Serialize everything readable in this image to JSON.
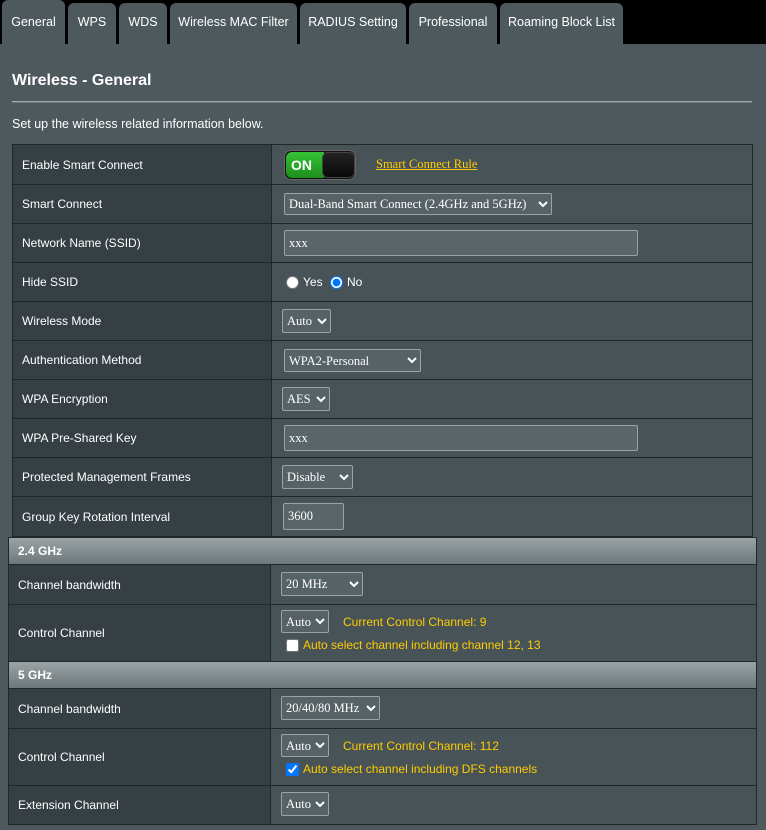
{
  "tabs": [
    {
      "label": "General",
      "active": true
    },
    {
      "label": "WPS"
    },
    {
      "label": "WDS"
    },
    {
      "label": "Wireless MAC Filter"
    },
    {
      "label": "RADIUS Setting"
    },
    {
      "label": "Professional"
    },
    {
      "label": "Roaming Block List"
    }
  ],
  "page": {
    "title": "Wireless - General",
    "description": "Set up the wireless related information below."
  },
  "general": {
    "smart_connect_enable": {
      "label": "Enable Smart Connect",
      "toggle": "ON",
      "rule_link": "Smart Connect Rule"
    },
    "smart_connect": {
      "label": "Smart Connect",
      "value": "Dual-Band Smart Connect (2.4GHz and 5GHz)"
    },
    "ssid": {
      "label": "Network Name (SSID)",
      "value": "xxx"
    },
    "hide_ssid": {
      "label": "Hide SSID",
      "yes": "Yes",
      "no": "No",
      "selected": "No"
    },
    "wireless_mode": {
      "label": "Wireless Mode",
      "value": "Auto"
    },
    "auth_method": {
      "label": "Authentication Method",
      "value": "WPA2-Personal"
    },
    "wpa_encryption": {
      "label": "WPA Encryption",
      "value": "AES"
    },
    "wpa_psk": {
      "label": "WPA Pre-Shared Key",
      "value": "xxx"
    },
    "pmf": {
      "label": "Protected Management Frames",
      "value": "Disable"
    },
    "group_key": {
      "label": "Group Key Rotation Interval",
      "value": "3600"
    }
  },
  "band_24": {
    "header": "2.4 GHz",
    "bandwidth": {
      "label": "Channel bandwidth",
      "value": "20 MHz"
    },
    "control_channel": {
      "label": "Control Channel",
      "value": "Auto",
      "current": "Current Control Channel: 9",
      "auto_select": "Auto select channel including channel 12, 13",
      "auto_checked": false
    }
  },
  "band_5": {
    "header": "5 GHz",
    "bandwidth": {
      "label": "Channel bandwidth",
      "value": "20/40/80 MHz"
    },
    "control_channel": {
      "label": "Control Channel",
      "value": "Auto",
      "current": "Current Control Channel: 112",
      "auto_select": "Auto select channel including DFS channels",
      "auto_checked": true
    },
    "extension_channel": {
      "label": "Extension Channel",
      "value": "Auto"
    }
  },
  "colors": {
    "accent": "#ffcc00",
    "toggle_on": "#2fb52f",
    "panel": "#4d595d"
  }
}
